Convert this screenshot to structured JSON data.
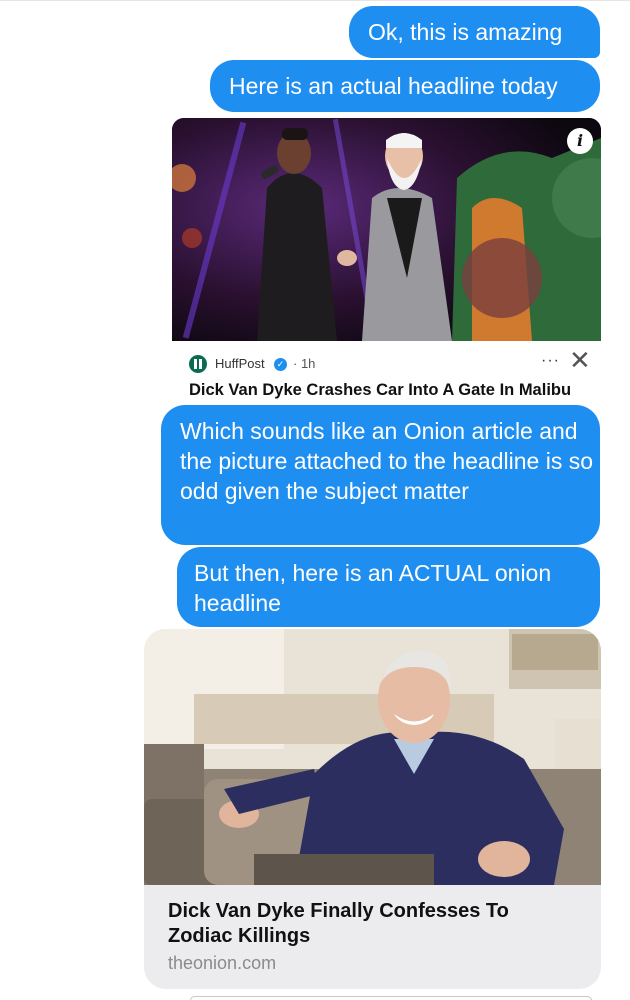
{
  "messages": [
    {
      "text": "Ok, this is amazing"
    },
    {
      "text": "Here is an actual headline today"
    },
    {
      "text": "Which sounds like an Onion article and the picture attached to the headline is so odd given the subject matter"
    },
    {
      "text": "But then, here is an ACTUAL onion headline"
    }
  ],
  "huffpost_card": {
    "source": "HuffPost",
    "time": "1h",
    "more": "···",
    "close": "✕",
    "info": "i",
    "title": "Dick Van Dyke Crashes Car Into A Gate In Malibu",
    "icons": [
      "info-icon",
      "verified-icon",
      "more-icon",
      "close-icon"
    ]
  },
  "onion_card": {
    "title": "Dick Van Dyke Finally Confesses To Zodiac Killings",
    "domain": "theonion.com"
  },
  "colors": {
    "bubble": "#1f8ef1",
    "card_bg": "#ececee",
    "huffpost_green": "#0b6b52"
  }
}
